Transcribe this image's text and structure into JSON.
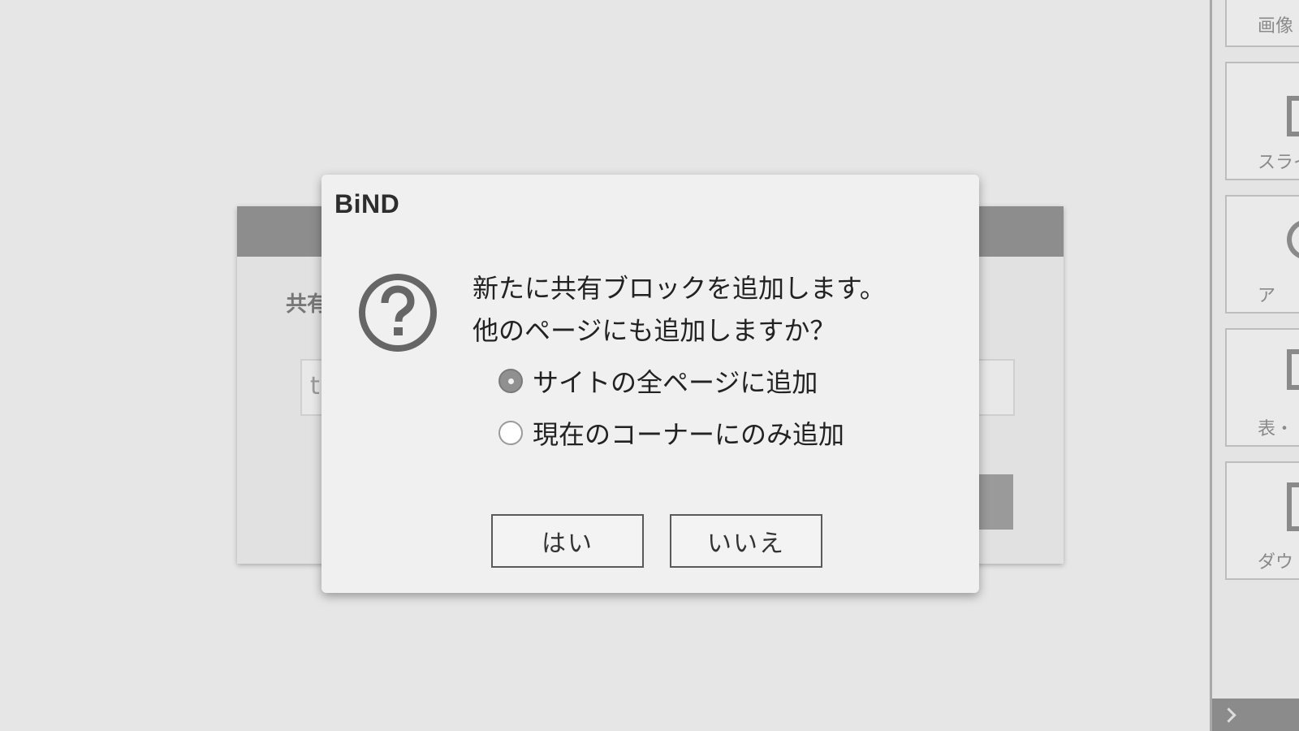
{
  "background_dialog": {
    "label_fragment": "共有",
    "input_fragment": "ti"
  },
  "side_panel": {
    "items": [
      {
        "label": "画像"
      },
      {
        "label": "スライ"
      },
      {
        "label": "ア"
      },
      {
        "label": "表・"
      },
      {
        "label": "ダウ"
      }
    ]
  },
  "dialog": {
    "title": "BiND",
    "message_line1": "新たに共有ブロックを追加します。",
    "message_line2": "他のページにも追加しますか？",
    "options": [
      {
        "label": "サイトの全ページに追加",
        "selected": true
      },
      {
        "label": "現在のコーナーにのみ追加",
        "selected": false
      }
    ],
    "yes_label": "はい",
    "no_label": "いいえ",
    "icon": "question-icon"
  },
  "colors": {
    "backdrop": "#e6e6e6",
    "dialog_bg": "#f0f0f0",
    "header_gray": "#8d8d8d",
    "icon_gray": "#666666"
  }
}
